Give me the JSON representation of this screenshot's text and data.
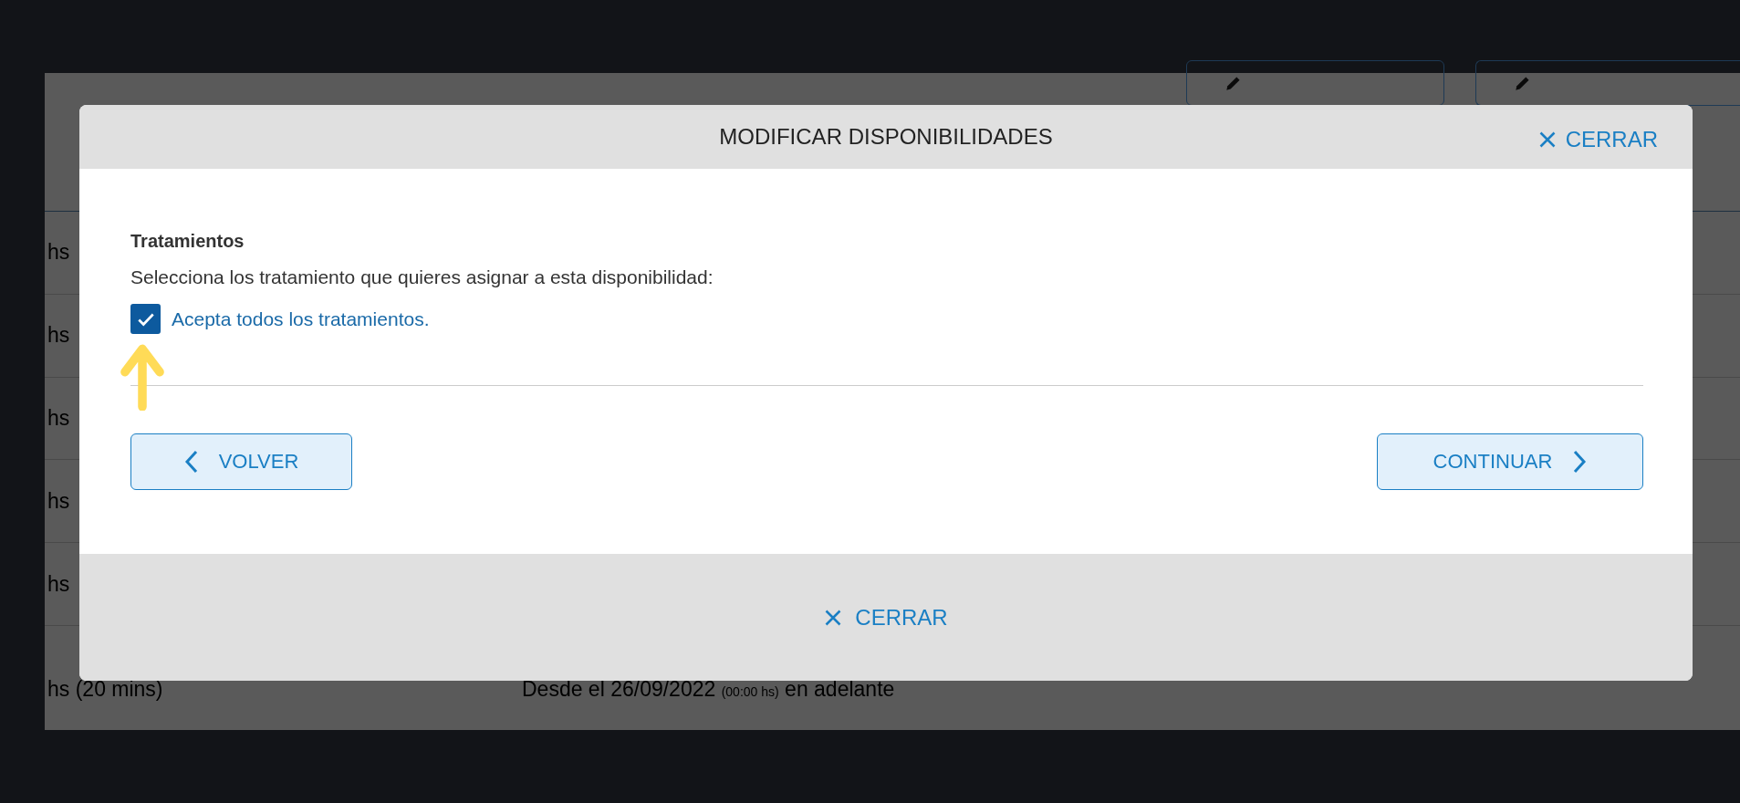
{
  "background_table": {
    "rows": [
      {
        "duration": "hs"
      },
      {
        "duration": "hs"
      },
      {
        "duration": "hs"
      },
      {
        "duration": "hs"
      },
      {
        "duration": "hs"
      },
      {
        "duration": "hs (20 mins)",
        "range_start": "Desde el 26/09/2022",
        "range_time": "(00:00 hs)",
        "range_end": "en adelante"
      }
    ]
  },
  "modal": {
    "title": "MODIFICAR DISPONIBILIDADES",
    "close_top": "CERRAR",
    "section_title": "Tratamientos",
    "instruction": "Selecciona los tratamiento que quieres asignar a esta disponibilidad:",
    "checkbox": {
      "label": "Acepta todos los tratamientos.",
      "checked": true
    },
    "back_button": "VOLVER",
    "continue_button": "CONTINUAR",
    "close_bottom": "CERRAR"
  }
}
